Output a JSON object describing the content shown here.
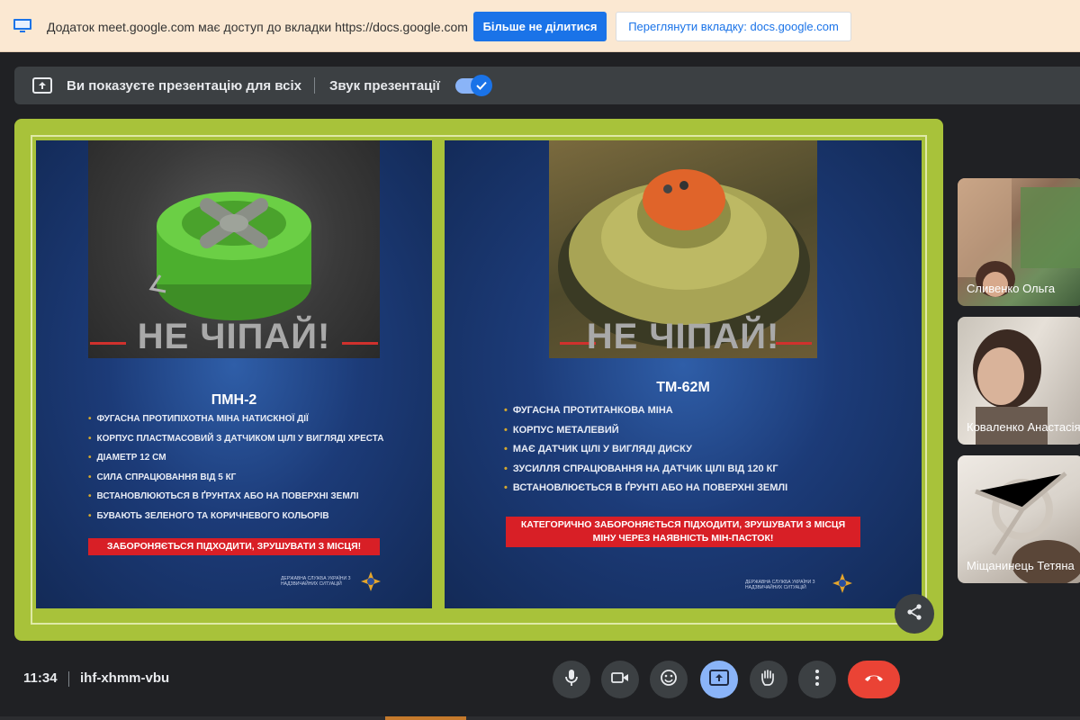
{
  "share_banner": {
    "message": "Додаток meet.google.com має доступ до вкладки https://docs.google.com",
    "stop_label": "Більше не ділитися",
    "view_label": "Переглянути вкладку: docs.google.com"
  },
  "present_bar": {
    "status": "Ви показуєте презентацію для всіх",
    "audio_label": "Звук презентації",
    "audio_on": true
  },
  "slides": [
    {
      "warning": "НЕ ЧІПАЙ!",
      "title": "ПМН-2",
      "bullets": [
        "ФУГАСНА ПРОТИПІХОТНА МІНА НАТИСКНОЇ ДІЇ",
        "КОРПУС ПЛАСТМАСОВИЙ З ДАТЧИКОМ ЦІЛІ У ВИГЛЯДІ ХРЕСТА",
        "ДІАМЕТР 12 СМ",
        "СИЛА СПРАЦЮВАННЯ ВІД 5 КГ",
        "ВСТАНОВЛЮЮТЬСЯ В ҐРУНТАХ АБО НА ПОВЕРХНІ ЗЕМЛІ",
        "БУВАЮТЬ ЗЕЛЕНОГО ТА КОРИЧНЕВОГО КОЛЬОРІВ"
      ],
      "alert": "ЗАБОРОНЯЄТЬСЯ ПІДХОДИТИ, ЗРУШУВАТИ З МІСЦЯ!",
      "agency": "ДЕРЖАВНА СЛУЖБА УКРАЇНИ З НАДЗВИЧАЙНИХ СИТУАЦІЙ"
    },
    {
      "warning": "НЕ ЧІПАЙ!",
      "title": "ТМ-62М",
      "bullets": [
        "ФУГАСНА ПРОТИТАНКОВА МІНА",
        "КОРПУС МЕТАЛЕВИЙ",
        "МАЄ ДАТЧИК ЦІЛІ У ВИГЛЯДІ ДИСКУ",
        "ЗУСИЛЛЯ СПРАЦЮВАННЯ НА ДАТЧИК ЦІЛІ ВІД 120 КГ",
        "ВСТАНОВЛЮЄТЬСЯ В ҐРУНТІ АБО НА ПОВЕРХНІ ЗЕМЛІ"
      ],
      "alert": "КАТЕГОРИЧНО ЗАБОРОНЯЄТЬСЯ ПІДХОДИТИ, ЗРУШУВАТИ З МІСЦЯ МІНУ ЧЕРЕЗ НАЯВНІСТЬ МІН-ПАСТОК!",
      "agency": "ДЕРЖАВНА СЛУЖБА УКРАЇНИ З НАДЗВИЧАЙНИХ СИТУАЦІЙ"
    }
  ],
  "participants": [
    {
      "name": "Сливенко Ольга"
    },
    {
      "name": "Коваленко Анастасія"
    },
    {
      "name": "Міщанинець Тетяна"
    }
  ],
  "meeting": {
    "time": "11:34",
    "code": "ihf-xhmm-vbu"
  },
  "colors": {
    "accent": "#1a73e8",
    "stage_border": "#a8c23a",
    "slide_alert": "#d81f26",
    "end_call": "#ea4335"
  },
  "controls": [
    {
      "name": "mic-icon"
    },
    {
      "name": "camera-icon"
    },
    {
      "name": "emoji-icon"
    },
    {
      "name": "present-screen-icon"
    },
    {
      "name": "raise-hand-icon"
    },
    {
      "name": "more-options-icon"
    },
    {
      "name": "end-call-icon"
    }
  ]
}
